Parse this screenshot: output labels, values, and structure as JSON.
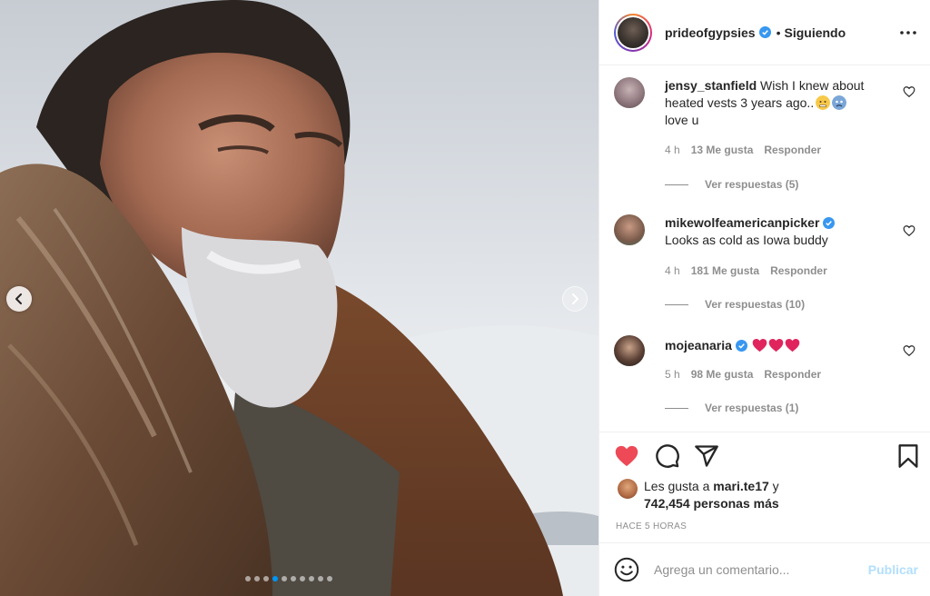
{
  "post": {
    "author": "prideofgypsies",
    "separator": "•",
    "follow_status": "Siguiendo",
    "more_icon": "more-horizontal-icon",
    "carousel": {
      "slide_count": 10,
      "active_index": 3
    }
  },
  "comments": [
    {
      "username": "jensy_stanfield",
      "verified": false,
      "text": "Wish I knew about heated vests 3 years ago..",
      "text_tail": "love u",
      "emojis": [
        "freezing-face-emoji",
        "cold-sweat-face-emoji"
      ],
      "time": "4 h",
      "likes": "13 Me gusta",
      "reply_label": "Responder",
      "view_replies": "Ver respuestas (5)"
    },
    {
      "username": "mikewolfeamericanpicker",
      "verified": true,
      "text": "Looks as cold as Iowa buddy",
      "time": "4 h",
      "likes": "181 Me gusta",
      "reply_label": "Responder",
      "view_replies": "Ver respuestas (10)"
    },
    {
      "username": "mojeanaria",
      "verified": true,
      "text": "",
      "emojis": [
        "red-heart-emoji",
        "red-heart-emoji",
        "red-heart-emoji"
      ],
      "time": "5 h",
      "likes": "98 Me gusta",
      "reply_label": "Responder",
      "view_replies": "Ver respuestas (1)"
    }
  ],
  "likes_summary": {
    "prefix": "Les gusta a",
    "user": "mari.te17",
    "joiner": "y",
    "others": "742,454 personas más"
  },
  "timestamp": "HACE 5 HORAS",
  "composer": {
    "placeholder": "Agrega un comentario...",
    "publish_label": "Publicar"
  },
  "colors": {
    "liked_heart": "#ed4956",
    "verified_badge": "#3897f0",
    "publish_disabled": "#b2dffc",
    "secondary_text": "#8e8e8e"
  }
}
